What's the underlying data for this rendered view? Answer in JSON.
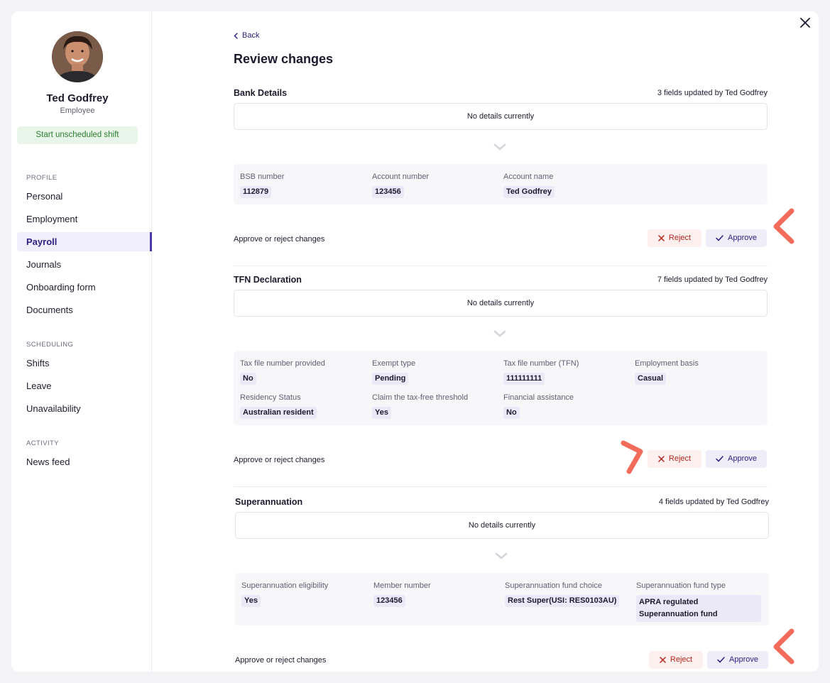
{
  "employee": {
    "name": "Ted Godfrey",
    "role": "Employee",
    "shift_button": "Start unscheduled shift"
  },
  "sidebar": {
    "profile_heading": "PROFILE",
    "profile_items": [
      "Personal",
      "Employment",
      "Payroll",
      "Journals",
      "Onboarding form",
      "Documents"
    ],
    "scheduling_heading": "SCHEDULING",
    "scheduling_items": [
      "Shifts",
      "Leave",
      "Unavailability"
    ],
    "activity_heading": "ACTIVITY",
    "activity_items": [
      "News feed"
    ],
    "active_item": "Payroll"
  },
  "header": {
    "back_label": "Back",
    "title": "Review changes"
  },
  "sections": [
    {
      "title": "Bank Details",
      "meta": "3 fields updated by Ted Godfrey",
      "placeholder": "No details currently",
      "fields": [
        {
          "label": "BSB number",
          "value": "112879"
        },
        {
          "label": "Account number",
          "value": "123456"
        },
        {
          "label": "Account name",
          "value": "Ted Godfrey"
        }
      ],
      "approve_text": "Approve or reject changes",
      "reject_label": "Reject",
      "approve_label": "Approve"
    },
    {
      "title": "TFN Declaration",
      "meta": "7 fields updated by Ted Godfrey",
      "placeholder": "No details currently",
      "fields": [
        {
          "label": "Tax file number provided",
          "value": "No"
        },
        {
          "label": "Exempt type",
          "value": "Pending"
        },
        {
          "label": "Tax file number (TFN)",
          "value": "111111111"
        },
        {
          "label": "Employment basis",
          "value": "Casual"
        },
        {
          "label": "Residency Status",
          "value": "Australian resident"
        },
        {
          "label": "Claim the tax-free threshold",
          "value": "Yes"
        },
        {
          "label": "Financial assistance",
          "value": "No"
        }
      ],
      "approve_text": "Approve or reject changes",
      "reject_label": "Reject",
      "approve_label": "Approve"
    },
    {
      "title": "Superannuation",
      "meta": "4 fields updated by Ted Godfrey",
      "placeholder": "No details currently",
      "fields": [
        {
          "label": "Superannuation eligibility",
          "value": "Yes"
        },
        {
          "label": "Member number",
          "value": "123456"
        },
        {
          "label": "Superannuation fund choice",
          "value": "Rest Super(USI: RES0103AU)"
        },
        {
          "label": "Superannuation fund type",
          "value": "APRA regulated Superannuation fund"
        }
      ],
      "approve_text": "Approve or reject changes",
      "reject_label": "Reject",
      "approve_label": "Approve"
    }
  ],
  "colors": {
    "accent": "#2c1e80",
    "reject": "#b3261e",
    "success": "#2e7d32",
    "annotation": "#f26b5b"
  },
  "icons": {
    "close": "close-icon",
    "back": "chevron-left-icon",
    "expand": "chevron-down-icon",
    "reject": "x-icon",
    "approve": "check-icon"
  }
}
